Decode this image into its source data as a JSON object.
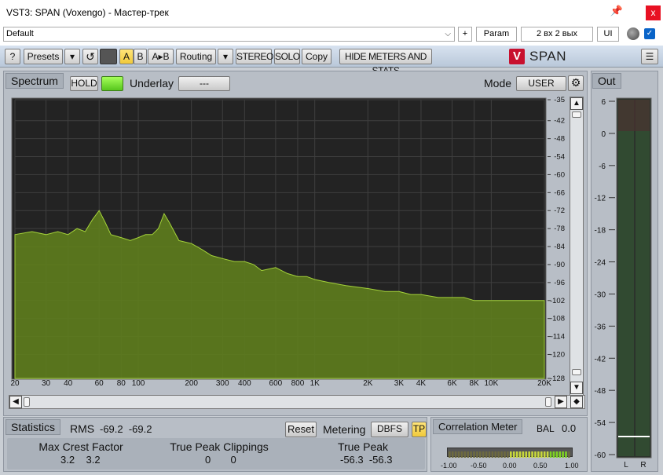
{
  "window": {
    "title": "VST3: SPAN (Voxengo) - Мастер-трек",
    "close": "x"
  },
  "host": {
    "preset": "Default",
    "plus": "+",
    "param": "Param",
    "io": "2 вх 2 вых",
    "ui": "UI"
  },
  "toolbar": {
    "help": "?",
    "presets": "Presets",
    "a": "A",
    "b": "B",
    "ab": "A▸B",
    "routing": "Routing",
    "stereo": "STEREO",
    "solo": "SOLO",
    "copy": "Copy",
    "hide": "HIDE METERS AND STATS",
    "logo": "SPAN"
  },
  "spectrum": {
    "title": "Spectrum",
    "hold": "HOLD",
    "underlay_label": "Underlay",
    "underlay_value": "---",
    "mode_label": "Mode",
    "mode_value": "USER"
  },
  "chart_data": {
    "type": "area",
    "x_ticks": [
      "20",
      "30",
      "40",
      "60",
      "80",
      "100",
      "200",
      "300",
      "400",
      "600",
      "800",
      "1K",
      "2K",
      "3K",
      "4K",
      "6K",
      "8K",
      "10K",
      "20K"
    ],
    "x_tick_values": [
      20,
      30,
      40,
      60,
      80,
      100,
      200,
      300,
      400,
      600,
      800,
      1000,
      2000,
      3000,
      4000,
      6000,
      8000,
      10000,
      20000
    ],
    "y_ticks": [
      "-35",
      "-42",
      "-48",
      "-54",
      "-60",
      "-66",
      "-72",
      "-78",
      "-84",
      "-90",
      "-96",
      "-102",
      "-108",
      "-114",
      "-120",
      "-128"
    ],
    "xlim": [
      20,
      20000
    ],
    "ylim": [
      -128,
      -35
    ],
    "x_scale": "log",
    "grid": true,
    "series": [
      {
        "x": [
          20,
          25,
          30,
          35,
          40,
          45,
          50,
          55,
          60,
          65,
          70,
          80,
          90,
          100,
          110,
          120,
          130,
          140,
          150,
          170,
          200,
          230,
          260,
          300,
          350,
          400,
          450,
          500,
          600,
          700,
          800,
          900,
          1000,
          1200,
          1500,
          2000,
          2500,
          3000,
          3500,
          4000,
          5000,
          6000,
          7000,
          8000,
          10000,
          12000,
          15000,
          20000
        ],
        "y": [
          -80,
          -79,
          -80,
          -79,
          -80,
          -78,
          -79,
          -75,
          -72,
          -76,
          -80,
          -81,
          -82,
          -81,
          -80,
          -80,
          -78,
          -73,
          -76,
          -82,
          -83,
          -85,
          -87,
          -88,
          -89,
          -89,
          -90,
          -92,
          -91,
          -93,
          -94,
          -94,
          -95,
          -96,
          -97,
          -98,
          -99,
          -99,
          -100,
          -100,
          -101,
          -101,
          -101,
          -102,
          -102,
          -102,
          -102,
          -102
        ]
      }
    ]
  },
  "out": {
    "title": "Out",
    "scale": [
      "6",
      "0",
      "-6",
      "-12",
      "-18",
      "-24",
      "-30",
      "-36",
      "-42",
      "-48",
      "-54",
      "-60"
    ],
    "l": "L",
    "r": "R"
  },
  "stats": {
    "title": "Statistics",
    "rms_label": "RMS",
    "rms_values": "-69.2  -69.2",
    "reset": "Reset",
    "metering_label": "Metering",
    "dbfs": "DBFS",
    "tp": "TP",
    "crest_label": "Max Crest Factor",
    "crest_values": "3.2    3.2",
    "clip_label": "True Peak Clippings",
    "clip_values": "0       0",
    "peak_label": "True Peak",
    "peak_values": "-56.3  -56.3"
  },
  "correlation": {
    "title": "Correlation Meter",
    "bal_label": "BAL",
    "bal_value": "0.0",
    "scale": [
      "-1.00",
      "-0.50",
      "0.00",
      "0.50",
      "1.00"
    ]
  }
}
